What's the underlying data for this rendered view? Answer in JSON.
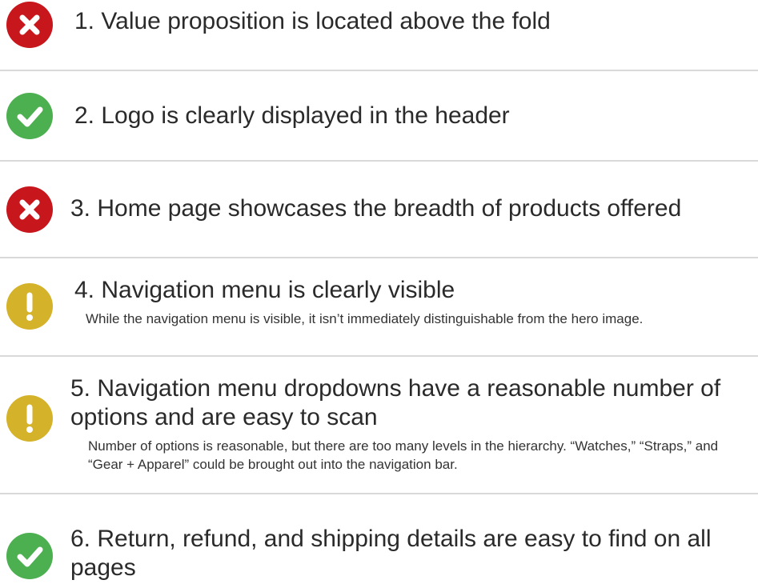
{
  "colors": {
    "fail": "#c8161d",
    "pass": "#4caf50",
    "warn": "#d4b22a"
  },
  "items": [
    {
      "status": "fail",
      "icon": "x-mark-icon",
      "title": "1. Value proposition is located above the fold",
      "note": ""
    },
    {
      "status": "pass",
      "icon": "checkmark-icon",
      "title": "2. Logo is clearly displayed in the header",
      "note": ""
    },
    {
      "status": "fail",
      "icon": "x-mark-icon",
      "title": "3. Home page showcases the breadth of products offered",
      "note": ""
    },
    {
      "status": "warn",
      "icon": "exclamation-icon",
      "title": "4. Navigation menu is clearly visible",
      "note": "While the navigation menu is visible, it isn’t immediately distinguishable from the hero image."
    },
    {
      "status": "warn",
      "icon": "exclamation-icon",
      "title": "5. Navigation menu dropdowns have a reasonable number of options and are easy to scan",
      "note": "Number of options is reasonable, but there are too many levels in the hierarchy. “Watches,” “Straps,” and “Gear + Apparel” could be brought out into the navigation bar."
    },
    {
      "status": "pass",
      "icon": "checkmark-icon",
      "title": "6. Return, refund, and shipping details are easy to find on all pages",
      "note": ""
    }
  ]
}
